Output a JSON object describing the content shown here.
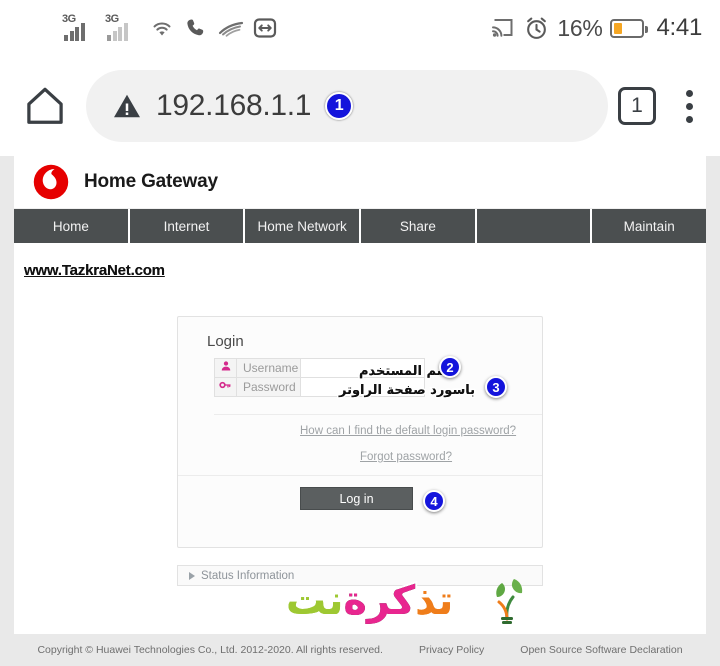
{
  "statusbar": {
    "icons": [
      "3g-signal-icon",
      "3g-signal-icon",
      "wifi-icon",
      "phone-call-icon",
      "signal-waves-icon",
      "data-transfer-icon",
      "cast-icon",
      "alarm-clock-icon",
      "battery-icon"
    ],
    "network_label": "3G",
    "battery_percent": "16%",
    "clock": "4:41"
  },
  "browser": {
    "home_icon": "home-icon",
    "security_icon": "not-secure-warning-icon",
    "url": "192.168.1.1",
    "url_badge": "1",
    "tab_count": "1",
    "menu_icon": "kebab-menu-icon"
  },
  "router": {
    "brand_logo": "vodafone-logo",
    "brand_title": "Home Gateway",
    "nav": [
      {
        "label": "Home"
      },
      {
        "label": "Internet"
      },
      {
        "label": "Home Network"
      },
      {
        "label": "Share"
      },
      {
        "label": ""
      },
      {
        "label": "Maintain"
      }
    ],
    "login": {
      "title": "Login",
      "username": {
        "label": "Username",
        "value": "",
        "icon": "user-icon"
      },
      "password": {
        "label": "Password",
        "value": "",
        "icon": "key-icon"
      },
      "help_link": "How can I find the default login password?",
      "forgot_link": "Forgot password?",
      "submit": "Log in"
    },
    "status_information": "Status Information",
    "footer": {
      "copyright": "Copyright © Huawei Technologies Co., Ltd. 2012-2020. All rights reserved.",
      "privacy": "Privacy Policy",
      "opensource": "Open Source Software Declaration"
    }
  },
  "annotations": {
    "watermark_url": "www.TazkraNet.com",
    "badges": [
      "1",
      "2",
      "3",
      "4"
    ],
    "note_username": "اسم المستخدم",
    "note_password": "باسورد صفحة الراوتر",
    "logo_parts": {
      "ta": "تذ",
      "ka": "كرة",
      "net": "نت"
    }
  }
}
